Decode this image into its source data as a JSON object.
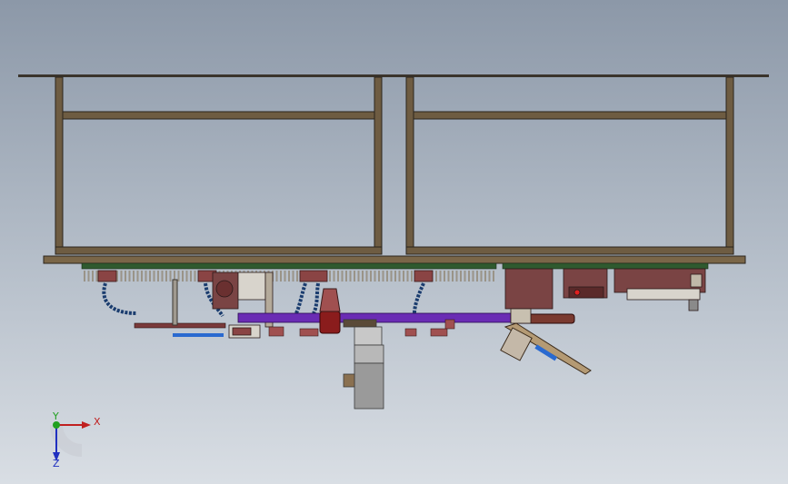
{
  "triad": {
    "x_label": "X",
    "y_label": "Y",
    "z_label": "Z",
    "x_color": "#c02020",
    "y_color": "#20a020",
    "z_color": "#2030c0"
  },
  "colors": {
    "frame": "#6e5c42",
    "frame_edge": "#2a241c",
    "rail": "#2f5a2f",
    "block": "#8a4444",
    "hose": "#1a3c6e",
    "conveyor": "#6a2cb4",
    "cylinder": "#9a9a9a"
  }
}
